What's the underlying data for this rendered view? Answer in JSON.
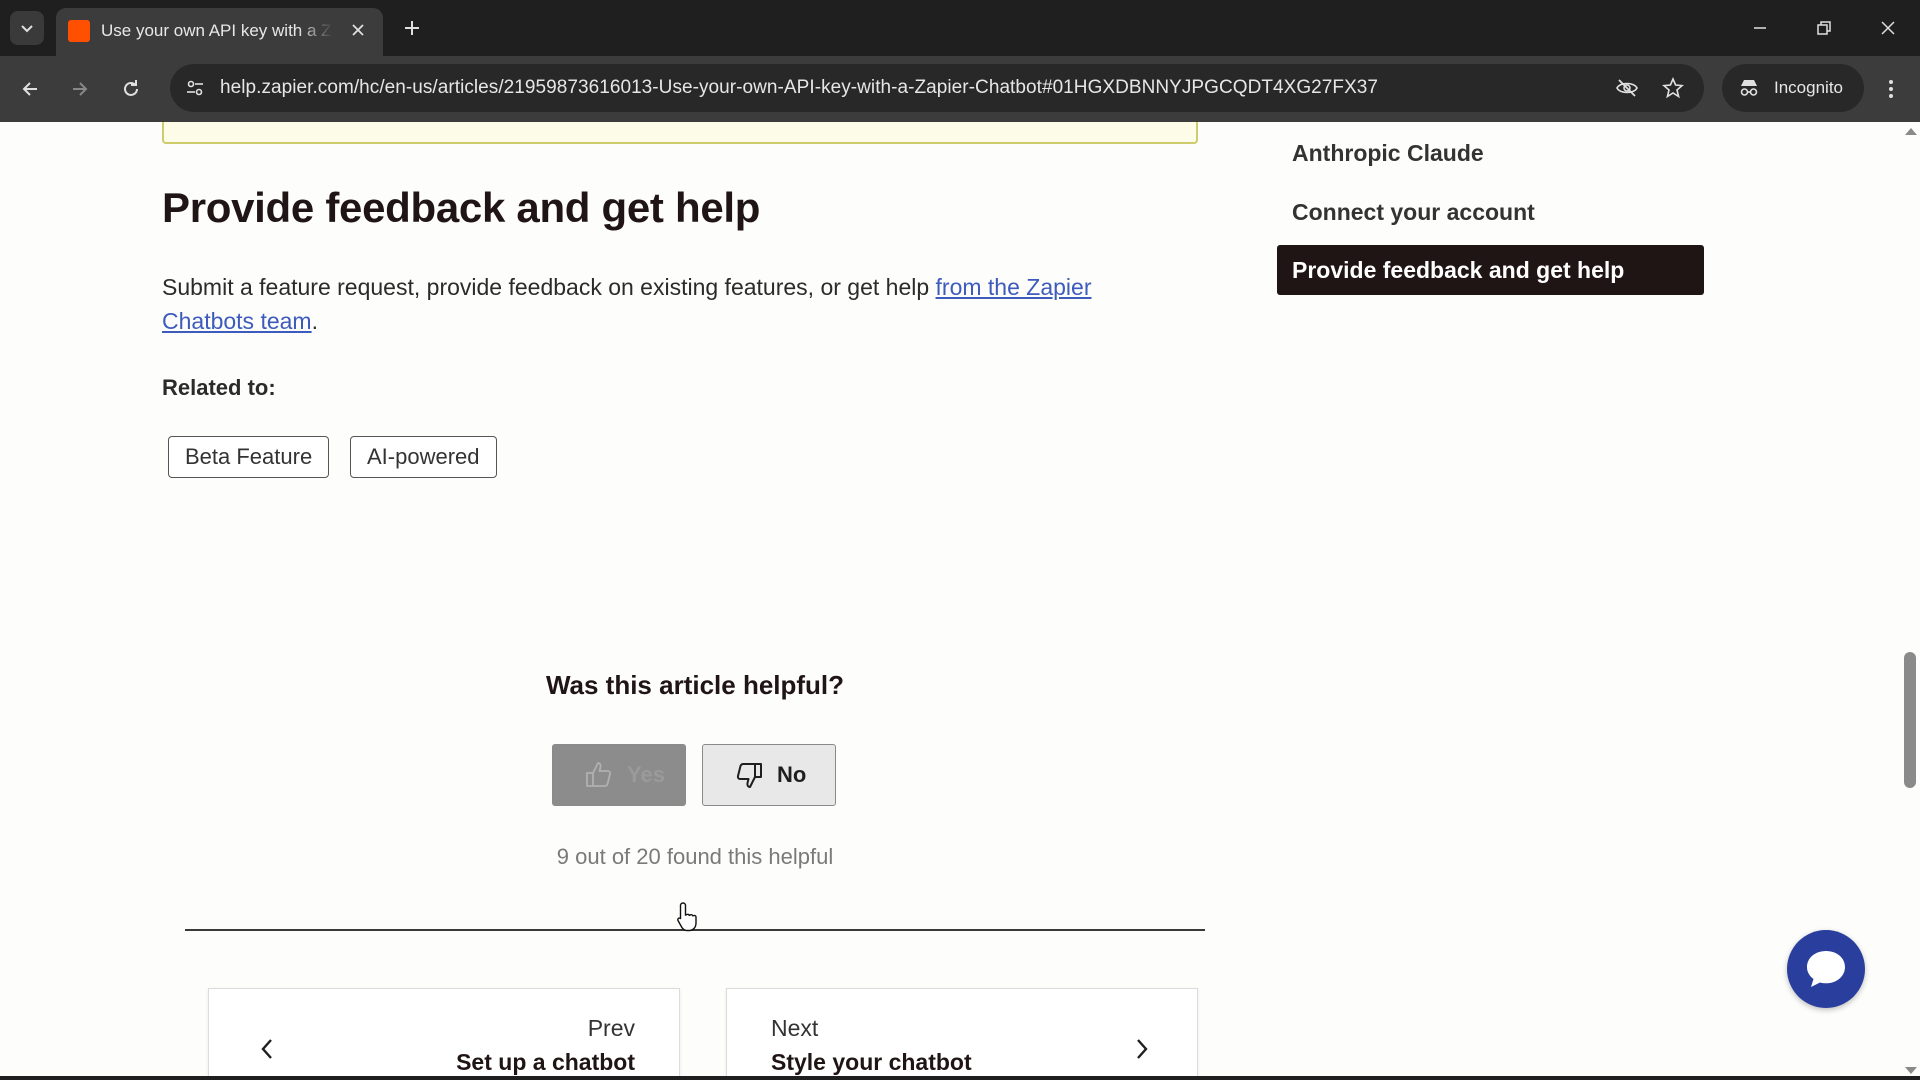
{
  "browser": {
    "tab_title": "Use your own API key with a Zapier Chatbot",
    "url": "help.zapier.com/hc/en-us/articles/21959873616013-Use-your-own-API-key-with-a-Zapier-Chatbot#01HGXDBNNYJPGCQDT4XG27FX37",
    "incognito_label": "Incognito"
  },
  "article": {
    "heading": "Provide feedback and get help",
    "para_text": "Submit a feature request, provide feedback on existing features, or get help ",
    "para_link": "from the Zapier Chatbots team",
    "para_end": ".",
    "related_label": "Related to:",
    "tags": [
      "Beta Feature",
      "AI-powered"
    ]
  },
  "feedback": {
    "question": "Was this article helpful?",
    "yes_label": "Yes",
    "no_label": "No",
    "count_text": "9 out of 20 found this helpful"
  },
  "pager": {
    "prev_small": "Prev",
    "prev_title": "Set up a chatbot",
    "next_small": "Next",
    "next_title": "Style your chatbot"
  },
  "toc": {
    "items": [
      "Anthropic Claude",
      "Connect your account"
    ],
    "active": "Provide feedback and get help"
  },
  "colors": {
    "accent": "#ff4f00",
    "link": "#3d5bbd",
    "toc_active_bg": "#201515",
    "chat_bubble": "#2a3f9d"
  }
}
